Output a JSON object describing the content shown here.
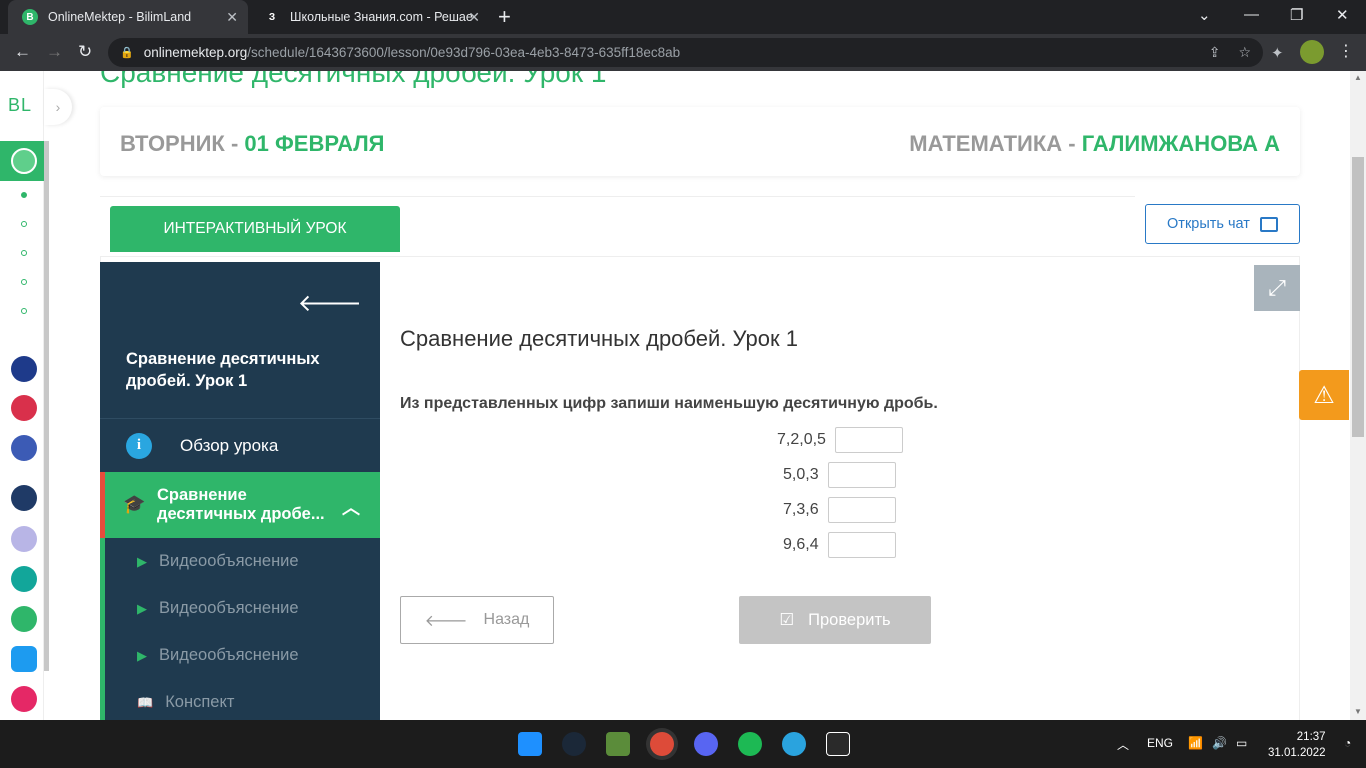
{
  "browser": {
    "tabs": [
      {
        "favicon": "B",
        "title": "OnlineMektep - BilimLand",
        "active": true
      },
      {
        "favicon": "З",
        "title": "Школьные Знания.com - Решае",
        "active": false
      }
    ],
    "url_host": "onlinemektep.org",
    "url_path": "/schedule/1643673600/lesson/0e93d796-03ea-4eb3-8473-635ff18ec8ab"
  },
  "leftbar": {
    "logo": "BL"
  },
  "header": {
    "lesson_title_cut": "Сравнение десятичных дробей. Урок 1",
    "day_prefix": "ВТОРНИК - ",
    "day_date": "01 ФЕВРАЛЯ",
    "subject_prefix": "МАТЕМАТИКА - ",
    "teacher": "ГАЛИМЖАНОВА А"
  },
  "interactive_button": "ИНТЕРАКТИВНЫЙ УРОК",
  "chat_button": "Открыть чат",
  "sidebar": {
    "title": "Сравнение десятичных дробей. Урок 1",
    "overview": "Обзор урока",
    "active_section": "Сравнение десятичных дробе...",
    "items": [
      {
        "label": "Видеообъяснение",
        "icon": "play-icon"
      },
      {
        "label": "Видеообъяснение",
        "icon": "play-icon"
      },
      {
        "label": "Видеообъяснение",
        "icon": "play-icon"
      },
      {
        "label": "Конспект",
        "icon": "book-icon"
      }
    ]
  },
  "task": {
    "heading": "Сравнение десятичных дробей. Урок 1",
    "question": "Из представленных цифр запиши наименьшую десятичную дробь.",
    "rows": [
      {
        "digits": "7,2,0,5",
        "value": ""
      },
      {
        "digits": "5,0,3",
        "value": ""
      },
      {
        "digits": "7,3,6",
        "value": ""
      },
      {
        "digits": "9,6,4",
        "value": ""
      }
    ],
    "back_button": "Назад",
    "check_button": "Проверить"
  },
  "taskbar": {
    "language": "ENG",
    "time": "21:37",
    "date": "31.01.2022"
  },
  "colors": {
    "accent": "#2fb66a",
    "sidebar": "#1f3a4f",
    "warning": "#f39a1c",
    "link": "#2979c6"
  }
}
